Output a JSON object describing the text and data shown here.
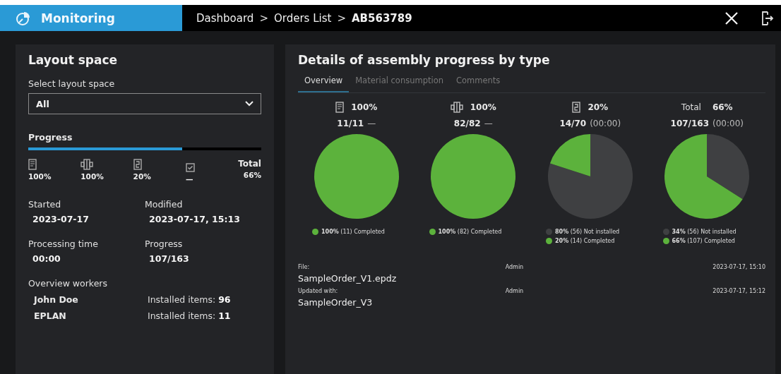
{
  "header": {
    "title": "Monitoring",
    "breadcrumb": [
      {
        "text": "Dashboard",
        "current": false
      },
      {
        "text": "Orders List",
        "current": false
      },
      {
        "text": "AB563789",
        "current": true
      }
    ],
    "separator": ">"
  },
  "layout_panel": {
    "title": "Layout space",
    "select_label": "Select layout space",
    "select_value": "All",
    "progress_label": "Progress",
    "level": 0.66,
    "types": [
      {
        "kind": "icon",
        "percent": "100%"
      },
      {
        "kind": "icon",
        "percent": "100%"
      },
      {
        "kind": "icon",
        "percent": "20%"
      },
      {
        "kind": "icon",
        "percent": "—"
      },
      {
        "kind": "total",
        "label": "Total",
        "percent": "66%"
      }
    ],
    "fields": [
      {
        "label": "Started",
        "value": "2023-07-17"
      },
      {
        "label": "Modified",
        "value": "2023-07-17, 15:13"
      },
      {
        "label": "Processing time",
        "value": "00:00"
      },
      {
        "label": "Progress",
        "value": "107/163"
      }
    ],
    "workers_label": "Overview workers",
    "workers": [
      {
        "name": "John Doe",
        "installed": "Installed items: **96**"
      },
      {
        "name": "EPLAN",
        "installed": "Installed items: **11**"
      }
    ]
  },
  "details_panel": {
    "title": "Details of assembly progress by type",
    "tabs": [
      {
        "label": "Overview",
        "selected": true
      },
      {
        "label": "Material consumption",
        "selected": false
      },
      {
        "label": "Comments",
        "selected": false
      }
    ],
    "charts": [
      {
        "kind": "icon",
        "percent": "100%",
        "count": "11/11",
        "extra": "—",
        "legend": [
          {
            "percent": "100%",
            "count": "(11)",
            "color": "#5cb23c"
          }
        ],
        "chart_data": {
          "type": "pie",
          "categories": [
            "Completed"
          ],
          "values": [
            100
          ]
        }
      },
      {
        "kind": "icon",
        "percent": "100%",
        "count": "82/82",
        "extra": "—",
        "legend": [
          {
            "percent": "100%",
            "count": "(82)",
            "color": "#5cb23c"
          }
        ],
        "chart_data": {
          "type": "pie",
          "categories": [
            "Completed"
          ],
          "values": [
            100
          ]
        }
      },
      {
        "kind": "icon",
        "percent": "20%",
        "count": "14/70",
        "extra": "(00:00)",
        "legend": [
          {
            "percent": "80%",
            "count": "(56)",
            "color": "#3f4042"
          },
          {
            "percent": "20%",
            "count": "(14)",
            "color": "#5cb23c"
          }
        ],
        "chart_data": {
          "type": "pie",
          "categories": [
            "Not installed",
            "Completed"
          ],
          "values": [
            80,
            20
          ]
        }
      },
      {
        "kind": "total",
        "label": "Total",
        "percent": "66%",
        "count": "107/163",
        "extra": "(00:00)",
        "legend": [
          {
            "percent": "34%",
            "count": "(56)",
            "color": "#3f4042"
          },
          {
            "percent": "66%",
            "count": "(107)",
            "color": "#5cb23c"
          }
        ],
        "chart_data": {
          "type": "pie",
          "categories": [
            "Not installed",
            "Completed"
          ],
          "values": [
            34,
            66
          ]
        }
      }
    ],
    "files": [
      {
        "label": "File:",
        "name": "SampleOrder_V1.epdz",
        "user": "Admin",
        "date": "2023-07-17, 15:10"
      },
      {
        "label": "Updated with:",
        "name": "SampleOrder_V3",
        "user": "Admin",
        "date": "2023-07-17, 15:12"
      }
    ]
  }
}
